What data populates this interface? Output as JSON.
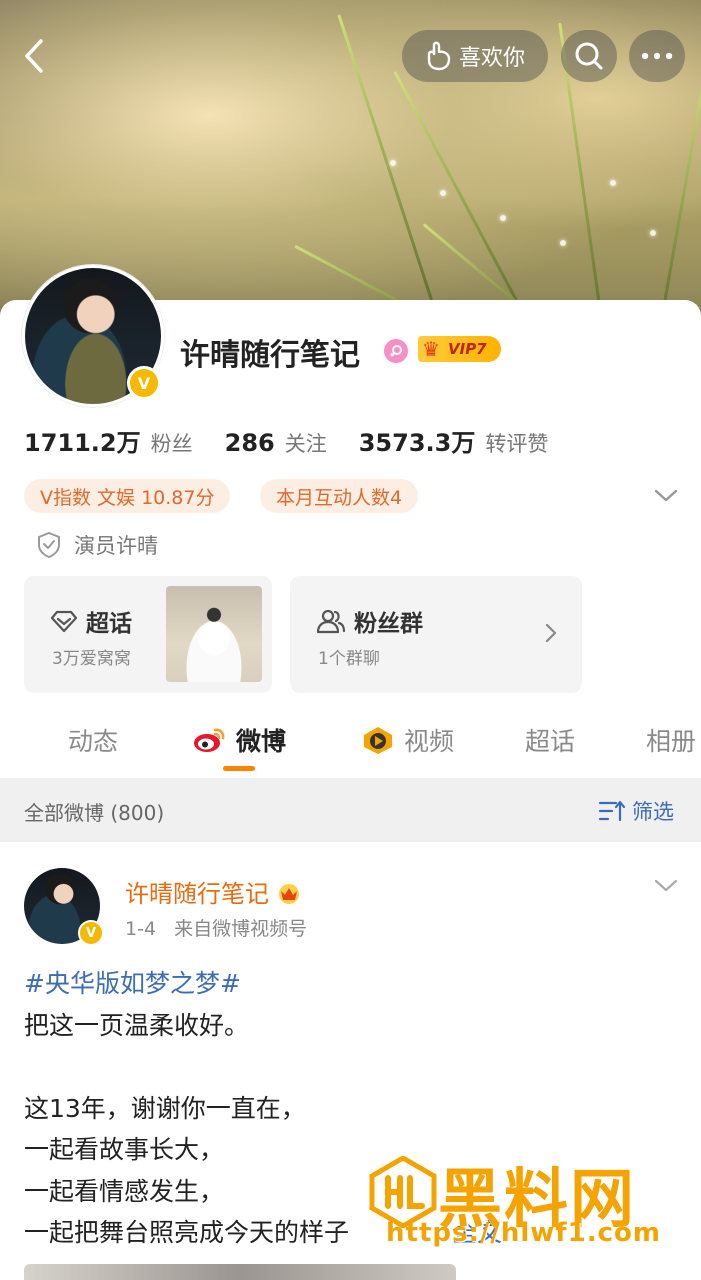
{
  "header": {
    "like_label": "喜欢你"
  },
  "profile": {
    "name": "许晴随行笔记",
    "vip_label": "VIP7",
    "stats": [
      {
        "value": "1711.2万",
        "label": "粉丝"
      },
      {
        "value": "286",
        "label": "关注"
      },
      {
        "value": "3573.3万",
        "label": "转评赞"
      }
    ],
    "tags": [
      "V指数 文娱 10.87分",
      "本月互动人数4"
    ],
    "identity": "演员许晴",
    "verified_badge": "V"
  },
  "tiles": {
    "chaohua": {
      "title": "超话",
      "subtitle": "3万爱窝窝"
    },
    "fans": {
      "title": "粉丝群",
      "subtitle": "1个群聊"
    }
  },
  "tabs": [
    {
      "label": "动态"
    },
    {
      "label": "微博",
      "active": true
    },
    {
      "label": "视频"
    },
    {
      "label": "超话"
    },
    {
      "label": "相册"
    }
  ],
  "filter": {
    "label": "全部微博 (800)",
    "button": "筛选"
  },
  "post": {
    "author": "许晴随行笔记",
    "date": "1-4",
    "source": "来自微博视频号",
    "hashtag": "#央华版如梦之梦#",
    "lines": [
      "把这一页温柔收好。",
      "这13年，谢谢你一直在，",
      "一起看故事长大，",
      "一起看情感发生，",
      "一起把舞台照亮成今天的样子"
    ],
    "expand_label": "全文"
  },
  "watermark": {
    "title": "黑料网",
    "url": "https://hlwf1.com"
  },
  "colors": {
    "accent_orange": "#ff8200",
    "link_blue": "#3c6db2",
    "author_orange": "#e86b0e",
    "tag_bg": "#fdeee4",
    "tag_text": "#e06a2b",
    "verified_yellow": "#f6b900"
  },
  "icons": [
    "back-arrow-icon",
    "heart-hand-icon",
    "search-icon",
    "more-icon",
    "female-icon",
    "crown-icon",
    "chevron-down-icon",
    "shield-icon",
    "diamond-icon",
    "group-icon",
    "chevron-right-icon",
    "weibo-logo-icon",
    "video-icon",
    "filter-icon"
  ]
}
